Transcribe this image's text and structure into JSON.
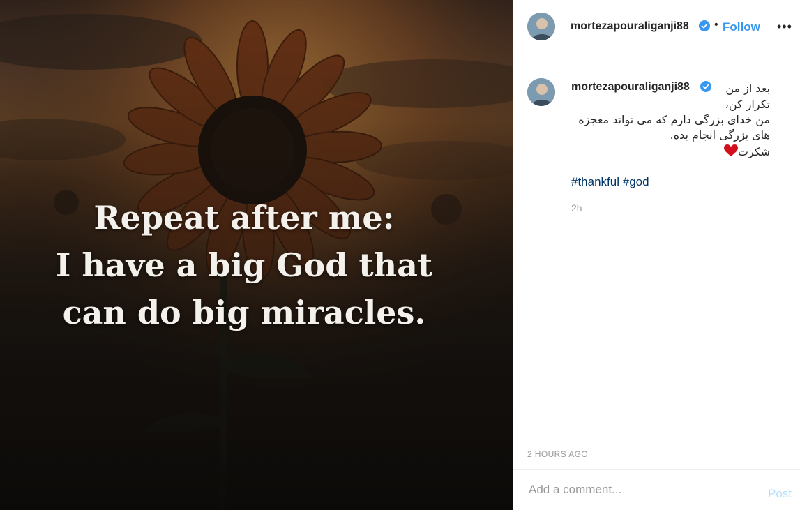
{
  "post": {
    "image_quote": [
      "Repeat after me:",
      "I have a big God that",
      "can do big miracles."
    ]
  },
  "header": {
    "username": "mortezapouraliganji88",
    "separator": "•",
    "follow_label": "Follow",
    "more_label": "•••"
  },
  "caption": {
    "username": "mortezapouraliganji88",
    "lines": [
      "بعد از من",
      "تکرار کن،",
      "من خدای بزرگی دارم که می تواند معجزه",
      "های بزرگی انجام بده.",
      "شکرت"
    ],
    "hashtags": [
      "#thankful",
      "#god"
    ],
    "time_ago": "2h"
  },
  "timestamp": "2 HOURS AGO",
  "comment_box": {
    "placeholder": "Add a comment...",
    "post_label": "Post"
  },
  "colors": {
    "link_blue": "#3897f0",
    "hashtag": "#003569",
    "post_disabled": "#b2dffc",
    "muted": "#999999"
  }
}
